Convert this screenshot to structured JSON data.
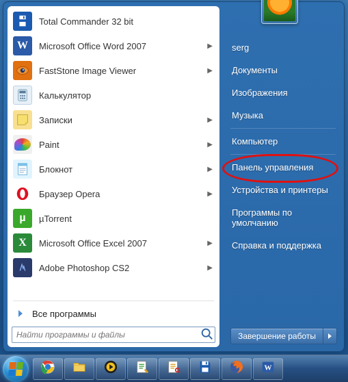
{
  "left_programs": [
    {
      "label": "Total Commander 32 bit",
      "icon": "save-icon",
      "has_submenu": false
    },
    {
      "label": "Microsoft Office Word 2007",
      "icon": "word-icon",
      "has_submenu": true
    },
    {
      "label": "FastStone Image Viewer",
      "icon": "eye-icon",
      "has_submenu": true
    },
    {
      "label": "Калькулятор",
      "icon": "calculator-icon",
      "has_submenu": false
    },
    {
      "label": "Записки",
      "icon": "sticky-notes-icon",
      "has_submenu": true
    },
    {
      "label": "Paint",
      "icon": "paint-icon",
      "has_submenu": true
    },
    {
      "label": "Блокнот",
      "icon": "notepad-icon",
      "has_submenu": true
    },
    {
      "label": "Браузер Opera",
      "icon": "opera-icon",
      "has_submenu": true
    },
    {
      "label": "µTorrent",
      "icon": "utorrent-icon",
      "has_submenu": false
    },
    {
      "label": "Microsoft Office Excel 2007",
      "icon": "excel-icon",
      "has_submenu": true
    },
    {
      "label": "Adobe Photoshop CS2",
      "icon": "photoshop-icon",
      "has_submenu": true
    }
  ],
  "all_programs_label": "Все программы",
  "search_placeholder": "Найти программы и файлы",
  "right_items": [
    {
      "label": "serg",
      "sep_after": false
    },
    {
      "label": "Документы",
      "sep_after": false
    },
    {
      "label": "Изображения",
      "sep_after": false
    },
    {
      "label": "Музыка",
      "sep_after": true
    },
    {
      "label": "Компьютер",
      "sep_after": true
    },
    {
      "label": "Панель управления",
      "sep_after": false
    },
    {
      "label": "Устройства и принтеры",
      "sep_after": false
    },
    {
      "label": "Программы по умолчанию",
      "sep_after": false
    },
    {
      "label": "Справка и поддержка",
      "sep_after": false
    }
  ],
  "highlighted_item_index": 5,
  "shutdown_label": "Завершение работы",
  "taskbar_icons": [
    "chrome-icon",
    "explorer-icon",
    "player-icon",
    "notepad2-icon",
    "image-viewer-icon",
    "save2-icon",
    "firefox-icon",
    "word2-icon"
  ],
  "colors": {
    "highlight": "#e01010"
  }
}
